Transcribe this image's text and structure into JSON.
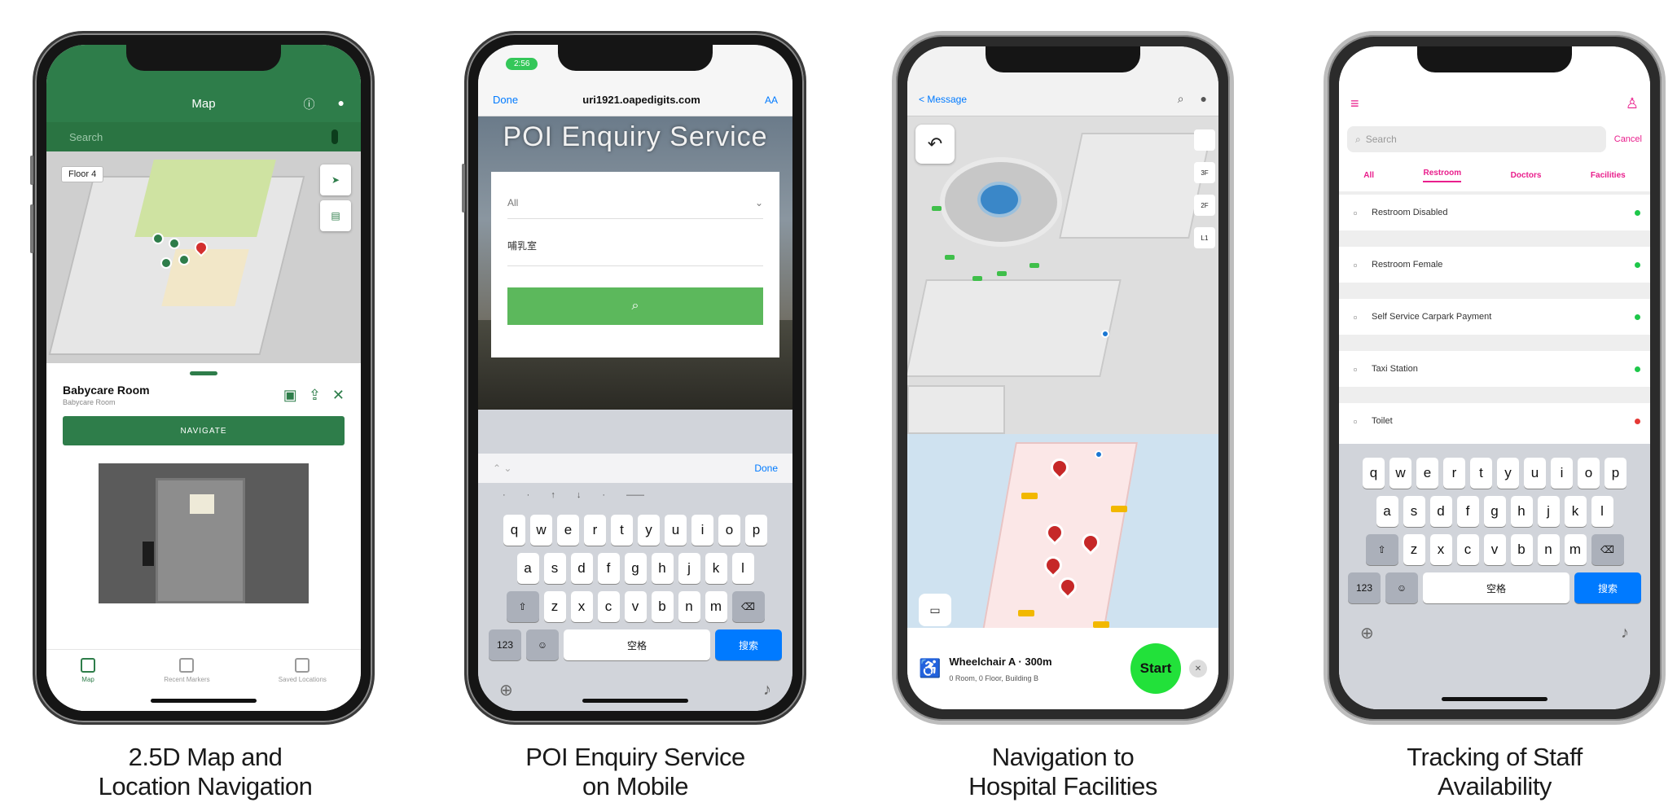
{
  "colors": {
    "map_green": "#2e7d4a",
    "ios_blue": "#007aff",
    "poi_button_green": "#5cb85c",
    "start_green": "#22e13a",
    "pin_red": "#c62828",
    "tracking_pink": "#e91e8c",
    "status_green": "#1ec74a",
    "status_red": "#e53935"
  },
  "captions": [
    {
      "line1": "2.5D Map and",
      "line2": "Location Navigation"
    },
    {
      "line1": "POI Enquiry Service",
      "line2": "on Mobile"
    },
    {
      "line1": "Navigation to",
      "line2": "Hospital Facilities"
    },
    {
      "line1": "Tracking of Staff",
      "line2": "Availability"
    }
  ],
  "phone1": {
    "title": "Map",
    "search_placeholder": "Search",
    "floor_chip": "Floor 4",
    "poi_title": "Babycare Room",
    "poi_subtitle": "Babycare Room",
    "navigate_label": "NAVIGATE",
    "tabs": [
      {
        "label": "Map",
        "icon": "map-icon"
      },
      {
        "label": "Recent Markers",
        "icon": "bookmark-icon"
      },
      {
        "label": "Saved Locations",
        "icon": "saved-icon"
      }
    ]
  },
  "phone2": {
    "status_time": "2:56",
    "done_label": "Done",
    "url": "uri1921.oapedigits.com",
    "aa_label": "AA",
    "hero_title": "POI Enquiry Service",
    "select_value": "All",
    "input_value": "哺乳室",
    "search_icon": "search-icon",
    "keyboard_done": "Done",
    "keyboard": {
      "suggestions": [
        "·",
        "·",
        "↑",
        "↓",
        "·",
        "——"
      ],
      "row1": [
        "q",
        "w",
        "e",
        "r",
        "t",
        "y",
        "u",
        "i",
        "o",
        "p"
      ],
      "row2": [
        "a",
        "s",
        "d",
        "f",
        "g",
        "h",
        "j",
        "k",
        "l"
      ],
      "row3": [
        "z",
        "x",
        "c",
        "v",
        "b",
        "n",
        "m"
      ],
      "num_key": "123",
      "space_label": "空格",
      "go_label": "搜索"
    }
  },
  "phone3": {
    "back_label": "< Message",
    "route_title": "Wheelchair A · 300m",
    "route_subtitle": "0 Room, 0 Floor, Building B",
    "start_label": "Start",
    "rail_labels": [
      "",
      "3F",
      "2F",
      "L1"
    ]
  },
  "phone4": {
    "search_placeholder": "Search",
    "cancel_label": "Cancel",
    "tabs": [
      "All",
      "Restroom",
      "Doctors",
      "Facilities"
    ],
    "active_tab": "Restroom",
    "items": [
      {
        "name": "Restroom Disabled",
        "icon": "wheelchair-icon",
        "status": "available"
      },
      {
        "name": "Restroom Female",
        "icon": "female-icon",
        "status": "available"
      },
      {
        "name": "Self Service Carpark Payment",
        "icon": "payment-icon",
        "status": "available"
      },
      {
        "name": "Taxi Station",
        "icon": "taxi-icon",
        "status": "available"
      },
      {
        "name": "Toilet",
        "icon": "toilet-icon",
        "status": "unavailable"
      }
    ],
    "keyboard": {
      "row1": [
        "q",
        "w",
        "e",
        "r",
        "t",
        "y",
        "u",
        "i",
        "o",
        "p"
      ],
      "row2": [
        "a",
        "s",
        "d",
        "f",
        "g",
        "h",
        "j",
        "k",
        "l"
      ],
      "row3": [
        "z",
        "x",
        "c",
        "v",
        "b",
        "n",
        "m"
      ],
      "num_key": "123",
      "space_label": "空格",
      "go_label": "搜索"
    }
  }
}
